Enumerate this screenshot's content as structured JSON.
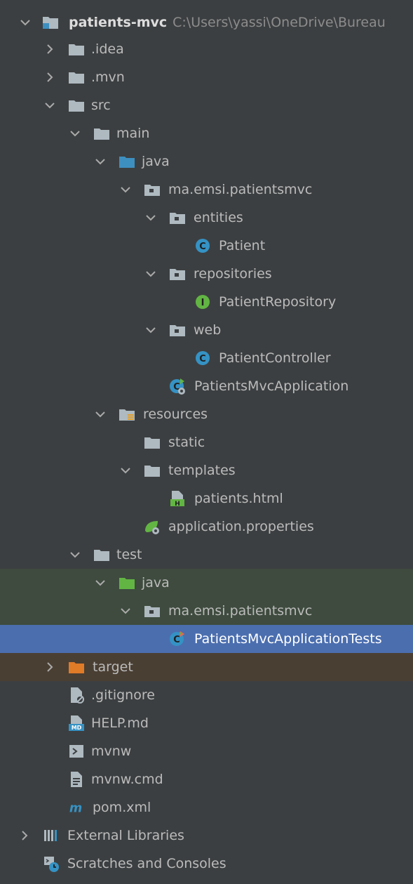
{
  "project": {
    "name": "patients-mvc",
    "path": "C:\\Users\\yassi\\OneDrive\\Bureau"
  },
  "items": [
    {
      "label": "patients-mvc",
      "depth": 0,
      "arrow": "down",
      "icon": "module-folder-icon"
    },
    {
      "label": ".idea",
      "depth": 1,
      "arrow": "right",
      "icon": "folder-icon"
    },
    {
      "label": ".mvn",
      "depth": 1,
      "arrow": "right",
      "icon": "folder-icon"
    },
    {
      "label": "src",
      "depth": 1,
      "arrow": "down",
      "icon": "folder-icon"
    },
    {
      "label": "main",
      "depth": 2,
      "arrow": "down",
      "icon": "folder-icon"
    },
    {
      "label": "java",
      "depth": 3,
      "arrow": "down",
      "icon": "source-folder-icon"
    },
    {
      "label": "ma.emsi.patientsmvc",
      "depth": 4,
      "arrow": "down",
      "icon": "package-icon"
    },
    {
      "label": "entities",
      "depth": 5,
      "arrow": "down",
      "icon": "package-icon"
    },
    {
      "label": "Patient",
      "depth": 6,
      "arrow": "",
      "icon": "class-icon"
    },
    {
      "label": "repositories",
      "depth": 5,
      "arrow": "down",
      "icon": "package-icon"
    },
    {
      "label": "PatientRepository",
      "depth": 6,
      "arrow": "",
      "icon": "interface-icon"
    },
    {
      "label": "web",
      "depth": 5,
      "arrow": "down",
      "icon": "package-icon"
    },
    {
      "label": "PatientController",
      "depth": 6,
      "arrow": "",
      "icon": "class-icon"
    },
    {
      "label": "PatientsMvcApplication",
      "depth": 5,
      "arrow": "",
      "icon": "spring-boot-class-icon"
    },
    {
      "label": "resources",
      "depth": 3,
      "arrow": "down",
      "icon": "resources-folder-icon"
    },
    {
      "label": "static",
      "depth": 4,
      "arrow": "",
      "icon": "folder-icon"
    },
    {
      "label": "templates",
      "depth": 4,
      "arrow": "down",
      "icon": "folder-icon"
    },
    {
      "label": "patients.html",
      "depth": 5,
      "arrow": "",
      "icon": "html-file-icon"
    },
    {
      "label": "application.properties",
      "depth": 4,
      "arrow": "",
      "icon": "spring-properties-icon"
    },
    {
      "label": "test",
      "depth": 2,
      "arrow": "down",
      "icon": "folder-icon"
    },
    {
      "label": "java",
      "depth": 3,
      "arrow": "down",
      "icon": "test-source-folder-icon"
    },
    {
      "label": "ma.emsi.patientsmvc",
      "depth": 4,
      "arrow": "down",
      "icon": "package-icon"
    },
    {
      "label": "PatientsMvcApplicationTests",
      "depth": 5,
      "arrow": "",
      "icon": "test-class-icon"
    },
    {
      "label": "target",
      "depth": 1,
      "arrow": "right",
      "icon": "excluded-folder-icon"
    },
    {
      "label": ".gitignore",
      "depth": 2,
      "arrow": "",
      "icon": "gitignore-file-icon"
    },
    {
      "label": "HELP.md",
      "depth": 2,
      "arrow": "",
      "icon": "markdown-file-icon"
    },
    {
      "label": "mvnw",
      "depth": 2,
      "arrow": "",
      "icon": "shell-script-icon"
    },
    {
      "label": "mvnw.cmd",
      "depth": 2,
      "arrow": "",
      "icon": "text-file-icon"
    },
    {
      "label": "pom.xml",
      "depth": 2,
      "arrow": "",
      "icon": "maven-icon"
    },
    {
      "label": "External Libraries",
      "depth": 0,
      "arrow": "right",
      "icon": "libraries-icon"
    },
    {
      "label": "Scratches and Consoles",
      "depth": 0,
      "arrow": "",
      "icon": "scratches-icon"
    }
  ],
  "selected_label": "PatientsMvcApplicationTests",
  "colors": {
    "background": "#3c3f41",
    "selection": "#4b6eaf",
    "test_source_row": "#3e4b3e",
    "excluded_row": "#4a3f33",
    "folder": "#aeb9c0",
    "source_folder": "#3d8fc0",
    "test_folder": "#62b543",
    "excluded_folder": "#e07b28",
    "class": "#3592c4",
    "interface": "#62b543"
  }
}
